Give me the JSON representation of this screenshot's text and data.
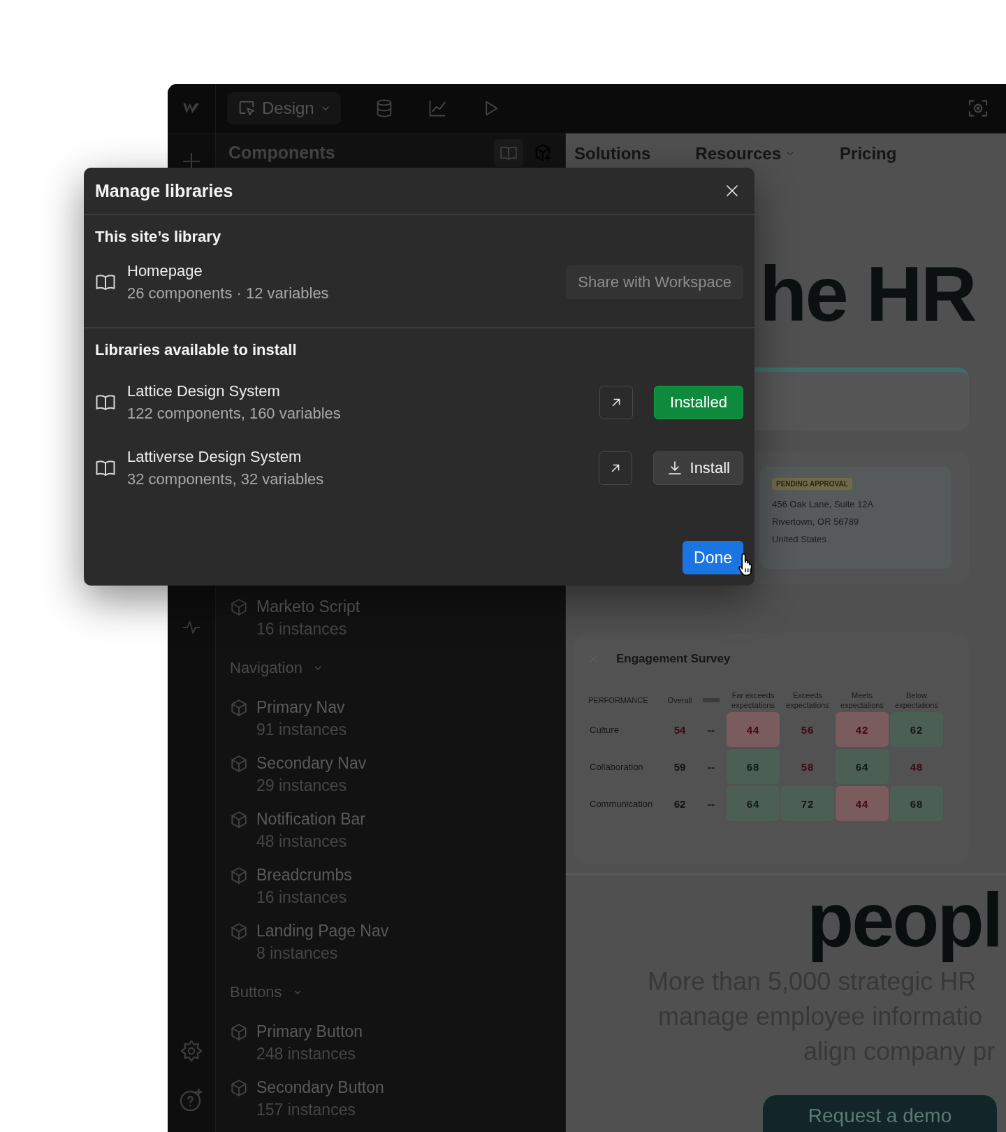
{
  "top_bar": {
    "mode_button": {
      "label": "Design"
    }
  },
  "sidebar": {
    "title": "Components",
    "items": [
      {
        "name": "Marketo Script",
        "count": "16 instances"
      }
    ],
    "groups": [
      {
        "heading": "Navigation",
        "expanded": true,
        "items": [
          {
            "name": "Primary Nav",
            "count": "91 instances"
          },
          {
            "name": "Secondary Nav",
            "count": "29 instances"
          },
          {
            "name": "Notification Bar",
            "count": "48 instances"
          },
          {
            "name": "Breadcrumbs",
            "count": "16 instances"
          },
          {
            "name": "Landing Page Nav",
            "count": "8 instances"
          }
        ]
      },
      {
        "heading": "Buttons",
        "expanded": true,
        "items": [
          {
            "name": "Primary Button",
            "count": "248 instances"
          },
          {
            "name": "Secondary Button",
            "count": "157 instances"
          }
        ]
      }
    ]
  },
  "canvas": {
    "nav": [
      {
        "label": "Solutions",
        "has_menu": false
      },
      {
        "label": "Resources",
        "has_menu": true
      },
      {
        "label": "Pricing",
        "has_menu": false
      }
    ],
    "hero_fragment": "he HR",
    "address_card": {
      "badge": "PENDING APPROVAL",
      "lines": [
        "456 Oak Lane, Suite 12A",
        "Rivertown, OR 56789",
        "United States"
      ]
    },
    "survey": {
      "title": "Engagement Survey",
      "columns": [
        "PERFORMANCE",
        "Overall",
        "Far exceeds expectations",
        "Exceeds expectations",
        "Meets expectations",
        "Below expectations"
      ],
      "rows": [
        {
          "label": "Culture",
          "overall": {
            "value": "54",
            "kind": "fair"
          },
          "trend": "--",
          "scores": [
            {
              "value": "44",
              "kind": "low"
            },
            {
              "value": "56",
              "kind": "fair"
            },
            {
              "value": "42",
              "kind": "low"
            },
            {
              "value": "62",
              "kind": "good"
            }
          ]
        },
        {
          "label": "Collaboration",
          "overall": {
            "value": "59",
            "kind": "neutral"
          },
          "trend": "--",
          "scores": [
            {
              "value": "68",
              "kind": "good"
            },
            {
              "value": "58",
              "kind": "fair"
            },
            {
              "value": "64",
              "kind": "good"
            },
            {
              "value": "48",
              "kind": "fair"
            }
          ]
        },
        {
          "label": "Communication",
          "overall": {
            "value": "62",
            "kind": "neutral"
          },
          "trend": "--",
          "scores": [
            {
              "value": "64",
              "kind": "good"
            },
            {
              "value": "72",
              "kind": "good"
            },
            {
              "value": "44",
              "kind": "low"
            },
            {
              "value": "68",
              "kind": "good"
            }
          ]
        }
      ]
    },
    "headline_fragment": "peopl",
    "subtitle_lines": [
      "More than 5,000 strategic HR",
      "manage employee informatio",
      "align company pr"
    ],
    "cta": "Request a demo"
  },
  "modal": {
    "title": "Manage libraries",
    "site_library": {
      "heading": "This site’s library",
      "name": "Homepage",
      "details": "26 components · 12 variables",
      "action": {
        "label": "Share with Workspace",
        "disabled": true
      }
    },
    "available": {
      "heading": "Libraries available to install",
      "libraries": [
        {
          "name": "Lattice Design System",
          "details": "122 components, 160 variables",
          "installed": true,
          "action": "Installed"
        },
        {
          "name": "Lattiverse Design System",
          "details": "32 components, 32 variables",
          "installed": false,
          "action": "Install"
        }
      ]
    },
    "done": "Done"
  }
}
